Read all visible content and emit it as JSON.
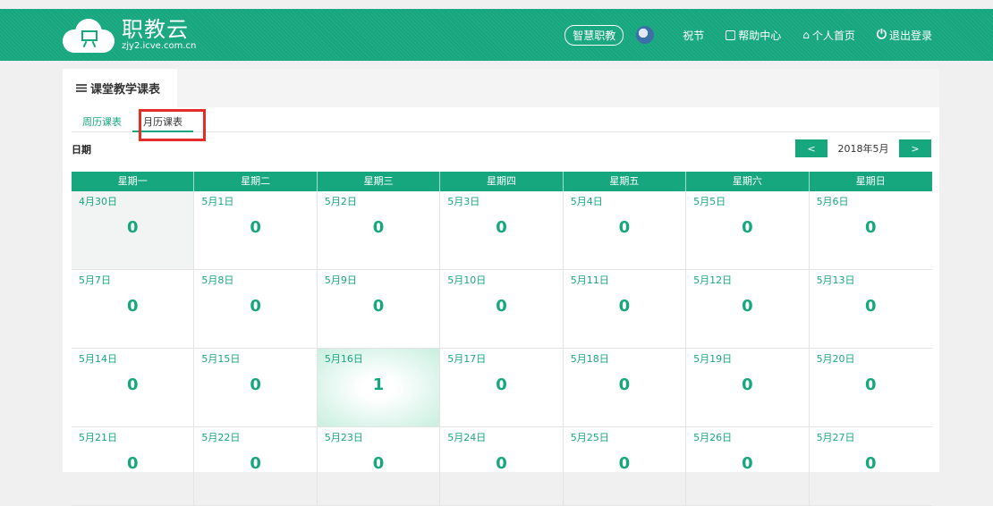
{
  "header": {
    "logo_title": "职教云",
    "logo_sub": "zjy2.icve.com.cn",
    "pill": "智慧职教",
    "user": "祝节",
    "help": "帮助中心",
    "home": "个人首页",
    "logout": "退出登录",
    "accent": "#17a77f"
  },
  "panel": {
    "title": "课堂教学课表",
    "subtabs": [
      "周历课表",
      "月历课表"
    ],
    "date_label": "日期",
    "prev": "<",
    "next": ">",
    "month": "2018年5月"
  },
  "calendar": {
    "weekdays": [
      "星期一",
      "星期二",
      "星期三",
      "星期四",
      "星期五",
      "星期六",
      "星期日"
    ],
    "cells": [
      {
        "date": "4月30日",
        "count": "0"
      },
      {
        "date": "5月1日",
        "count": "0"
      },
      {
        "date": "5月2日",
        "count": "0"
      },
      {
        "date": "5月3日",
        "count": "0"
      },
      {
        "date": "5月4日",
        "count": "0"
      },
      {
        "date": "5月5日",
        "count": "0"
      },
      {
        "date": "5月6日",
        "count": "0"
      },
      {
        "date": "5月7日",
        "count": "0"
      },
      {
        "date": "5月8日",
        "count": "0"
      },
      {
        "date": "5月9日",
        "count": "0"
      },
      {
        "date": "5月10日",
        "count": "0"
      },
      {
        "date": "5月11日",
        "count": "0"
      },
      {
        "date": "5月12日",
        "count": "0"
      },
      {
        "date": "5月13日",
        "count": "0"
      },
      {
        "date": "5月14日",
        "count": "0"
      },
      {
        "date": "5月15日",
        "count": "0"
      },
      {
        "date": "5月16日",
        "count": "1"
      },
      {
        "date": "5月17日",
        "count": "0"
      },
      {
        "date": "5月18日",
        "count": "0"
      },
      {
        "date": "5月19日",
        "count": "0"
      },
      {
        "date": "5月20日",
        "count": "0"
      },
      {
        "date": "5月21日",
        "count": "0"
      },
      {
        "date": "5月22日",
        "count": "0"
      },
      {
        "date": "5月23日",
        "count": "0"
      },
      {
        "date": "5月24日",
        "count": "0"
      },
      {
        "date": "5月25日",
        "count": "0"
      },
      {
        "date": "5月26日",
        "count": "0"
      },
      {
        "date": "5月27日",
        "count": "0"
      }
    ]
  }
}
